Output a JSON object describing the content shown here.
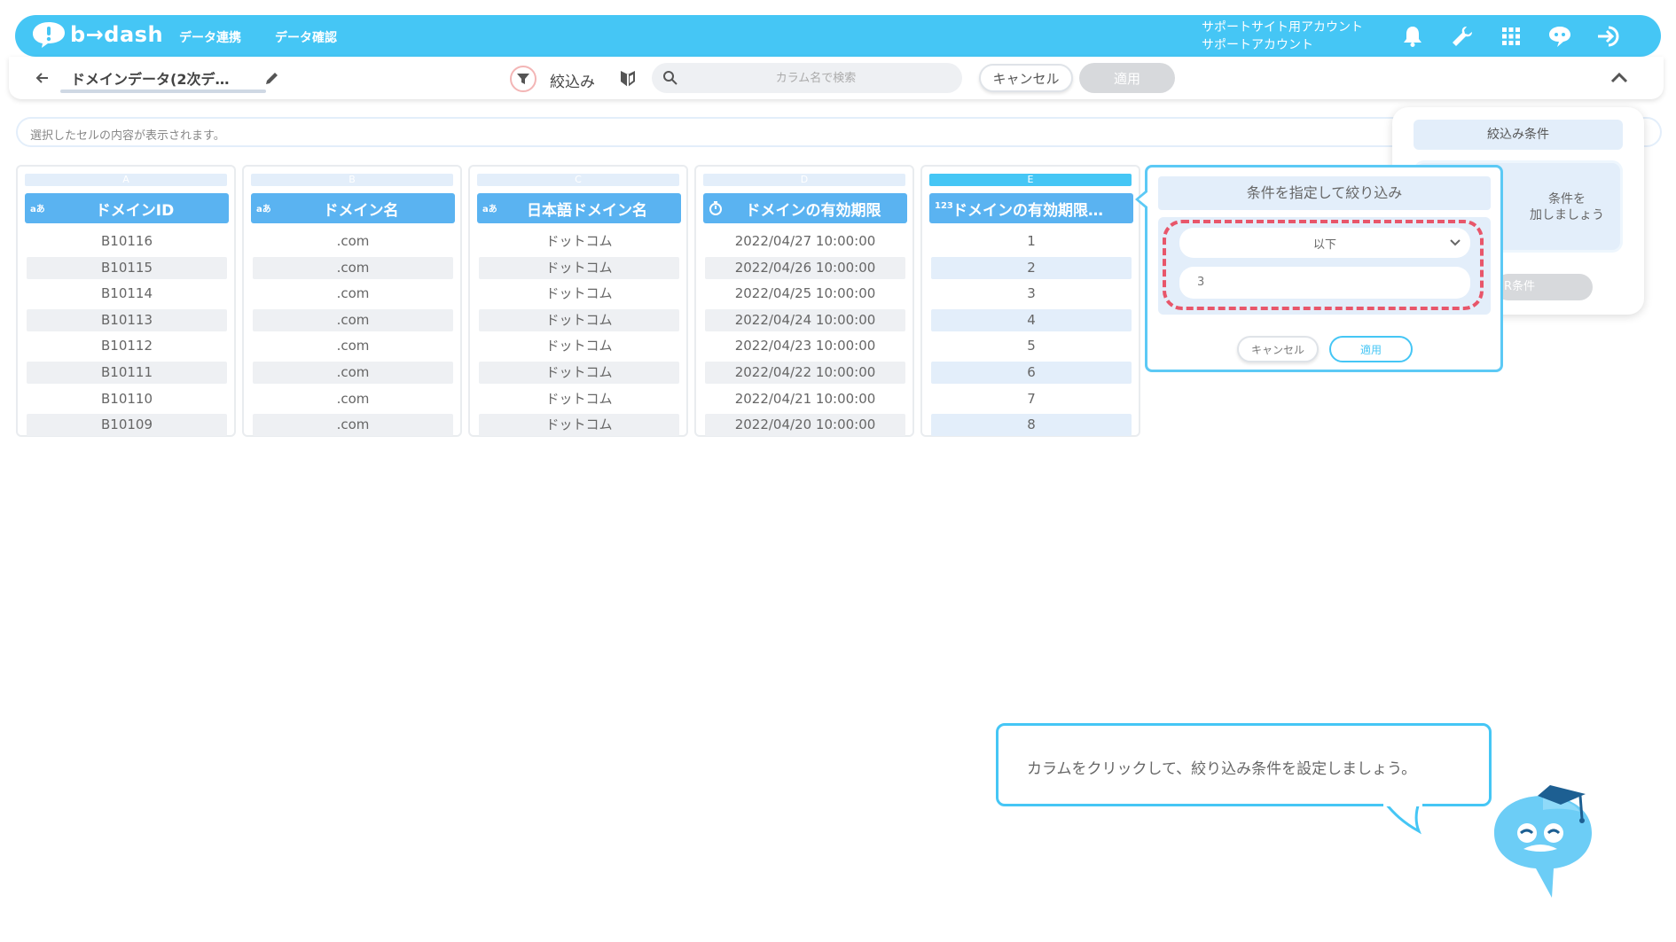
{
  "app": {
    "logo_text": "b→dash",
    "nav": [
      "データ連携",
      "データ確認"
    ],
    "account_line1": "サポートサイト用アカウント",
    "account_line2": "サポートアカウント",
    "brand_color": "#45c6f5"
  },
  "toolbar": {
    "doc_title": "ドメインデータ(2次デ…",
    "filter_label": "絞込み",
    "search_placeholder": "カラム名で検索",
    "cancel_label": "キャンセル",
    "apply_label": "適用"
  },
  "cellbar": {
    "placeholder": "選択したセルの内容が表示されます。"
  },
  "columns": [
    {
      "letter": "A",
      "type": "aあ",
      "name": "ドメインID",
      "rows": [
        "B10116",
        "B10115",
        "B10114",
        "B10113",
        "B10112",
        "B10111",
        "B10110",
        "B10109"
      ]
    },
    {
      "letter": "B",
      "type": "aあ",
      "name": "ドメイン名",
      "rows": [
        ".com",
        ".com",
        ".com",
        ".com",
        ".com",
        ".com",
        ".com",
        ".com"
      ]
    },
    {
      "letter": "C",
      "type": "aあ",
      "name": "日本語ドメイン名",
      "rows": [
        "ドットコム",
        "ドットコム",
        "ドットコム",
        "ドットコム",
        "ドットコム",
        "ドットコム",
        "ドットコム",
        "ドットコム"
      ]
    },
    {
      "letter": "D",
      "type": "clock",
      "name": "ドメインの有効期限",
      "rows": [
        "2022/04/27 10:00:00",
        "2022/04/26 10:00:00",
        "2022/04/25 10:00:00",
        "2022/04/24 10:00:00",
        "2022/04/23 10:00:00",
        "2022/04/22 10:00:00",
        "2022/04/21 10:00:00",
        "2022/04/20 10:00:00"
      ]
    },
    {
      "letter": "E",
      "type": "123",
      "name": "ドメインの有効期限…",
      "rows": [
        "1",
        "2",
        "3",
        "4",
        "5",
        "6",
        "7",
        "8"
      ]
    }
  ],
  "condition_popup": {
    "title": "条件を指定して絞り込み",
    "operator": "以下",
    "value": "3",
    "cancel_label": "キャンセル",
    "apply_label": "適用"
  },
  "filter_panel": {
    "title": "絞込み条件",
    "add_text_1": "条件を",
    "add_text_2": "加しましょう",
    "or_label": "R条件"
  },
  "tip": {
    "text": "カラムをクリックして、絞り込み条件を設定しましょう。"
  }
}
